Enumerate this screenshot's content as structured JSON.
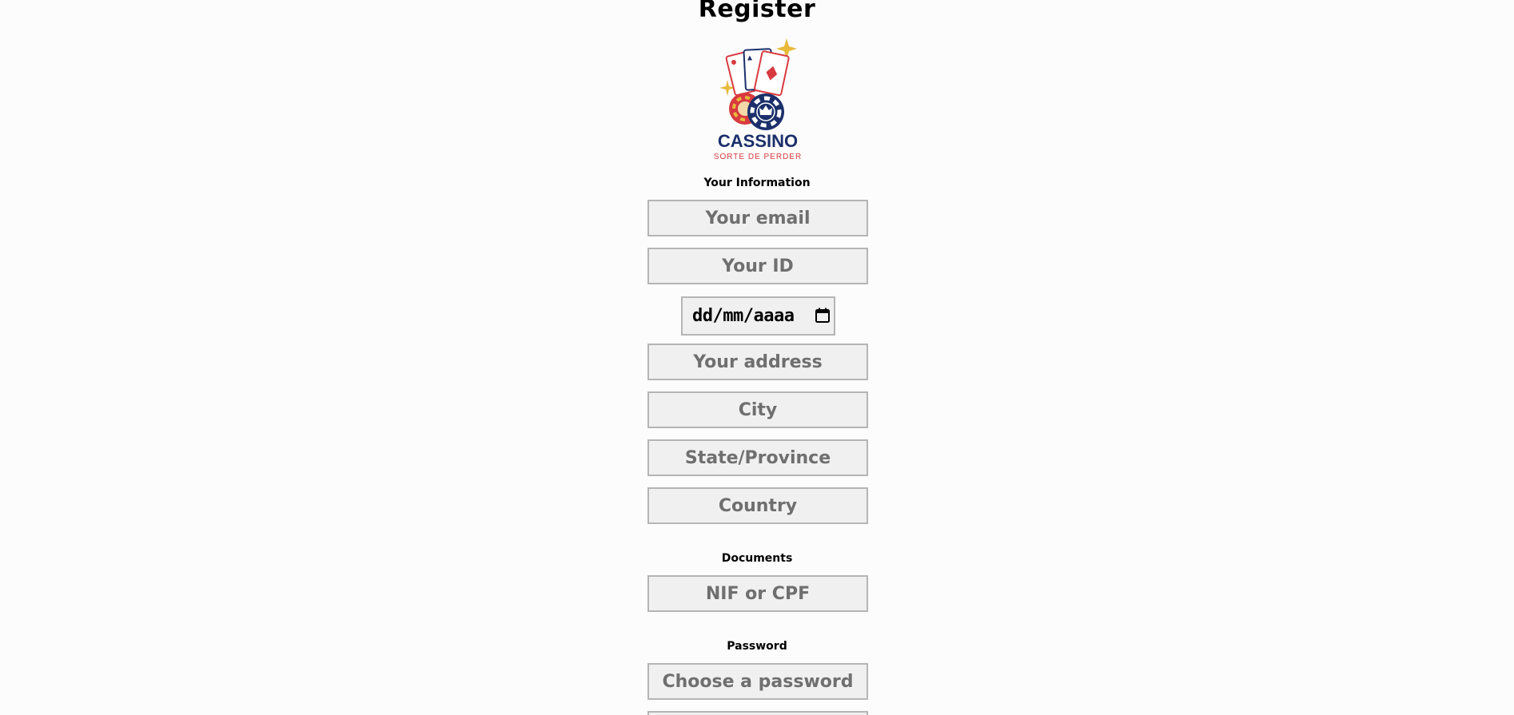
{
  "page": {
    "title": "Register"
  },
  "logo": {
    "name": "CASSINO",
    "tagline": "SORTE DE PERDER"
  },
  "sections": {
    "info_label": "Your Information",
    "documents_label": "Documents",
    "password_label": "Password"
  },
  "fields": {
    "email_placeholder": "Your email",
    "id_placeholder": "Your ID",
    "date_value": "dd/mm/aaaa",
    "address_placeholder": "Your address",
    "city_placeholder": "City",
    "state_placeholder": "State/Province",
    "country_placeholder": "Country",
    "nif_placeholder": "NIF or CPF",
    "password_placeholder": "Choose a password"
  },
  "colors": {
    "navy": "#1b2f6b",
    "red": "#d83a3f",
    "gold": "#e8b93a",
    "input_bg": "#f0f0f0",
    "input_border": "#b5b5b5"
  }
}
